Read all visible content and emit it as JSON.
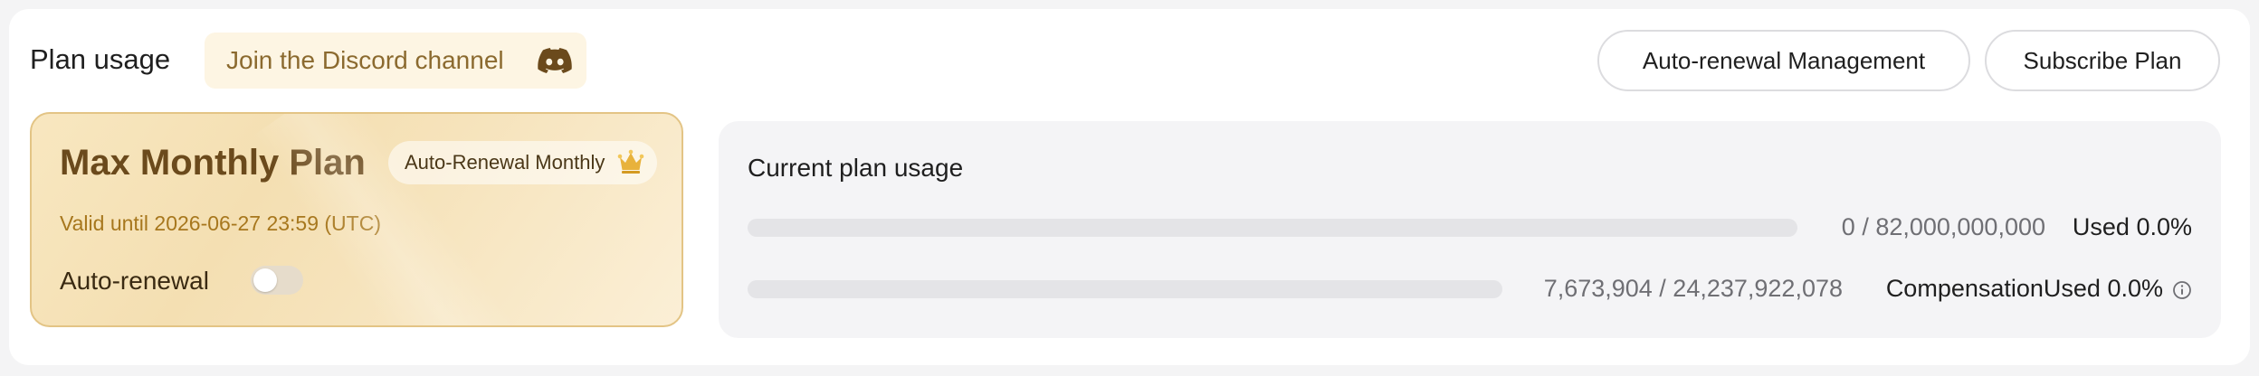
{
  "header": {
    "title": "Plan usage",
    "discord_label": "Join the Discord channel",
    "discord_icon": "discord-icon",
    "auto_renewal_button": "Auto-renewal Management",
    "subscribe_button": "Subscribe Plan"
  },
  "plan": {
    "name": "Max Monthly Plan",
    "badge": "Auto-Renewal Monthly",
    "badge_icon": "crown-icon",
    "valid_until": "Valid until 2026-06-27 23:59 (UTC)",
    "auto_renewal_label": "Auto-renewal",
    "auto_renewal_enabled": false
  },
  "usage": {
    "title": "Current plan usage",
    "rows": [
      {
        "amount": "0 / 82,000,000,000",
        "label": "Used 0.0%",
        "fill_percent": 0
      },
      {
        "amount": "7,673,904 / 24,237,922,078",
        "label": "CompensationUsed 0.0%",
        "fill_percent": 0,
        "info_icon": "info-icon"
      }
    ]
  },
  "colors": {
    "accent": "#8b6a2f",
    "card_gold": "#f4dfb2",
    "card_border": "#e3c485",
    "track": "#e4e4e7"
  }
}
